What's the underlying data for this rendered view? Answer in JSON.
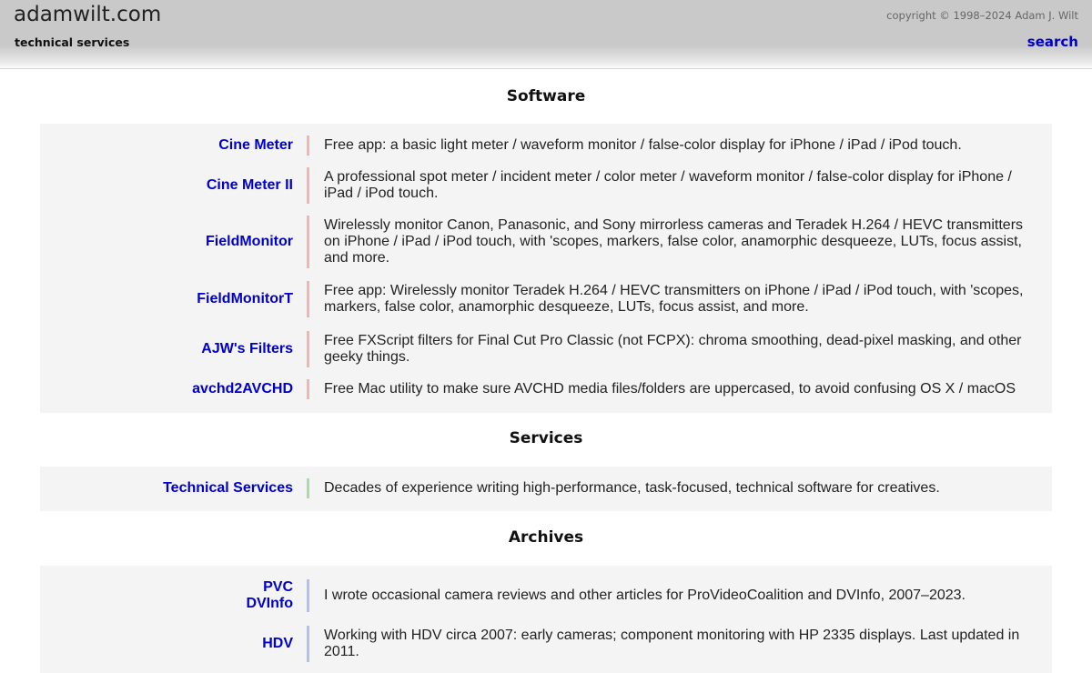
{
  "header": {
    "site_title": "adamwilt.com",
    "site_subtitle": "technical services",
    "copyright": "copyright © 1998–2024 Adam J. Wilt",
    "search_label": "search"
  },
  "sections": {
    "software": {
      "heading": "Software",
      "items": [
        {
          "name": "Cine Meter",
          "desc": "Free app: a basic light meter / waveform monitor / false-color display for iPhone / iPad / iPod touch."
        },
        {
          "name": "Cine Meter II",
          "desc": "A professional spot meter / incident meter / color meter / waveform monitor / false-color display for iPhone / iPad / iPod touch."
        },
        {
          "name": "FieldMonitor",
          "desc": "Wirelessly monitor Canon, Panasonic, and Sony mirrorless cameras and Teradek H.264 / HEVC transmitters on iPhone / iPad / iPod touch, with 'scopes, markers, false color, anamorphic desqueeze, LUTs, focus assist, and more."
        },
        {
          "name": "FieldMonitorT",
          "desc": "Free app: Wirelessly monitor Teradek H.264 / HEVC transmitters on iPhone / iPad / iPod touch, with 'scopes, markers, false color, anamorphic desqueeze, LUTs, focus assist, and more."
        },
        {
          "name": "AJW's Filters",
          "desc": "Free FXScript filters for Final Cut Pro Classic (not FCPX): chroma smoothing, dead-pixel masking, and other geeky things."
        },
        {
          "name": "avchd2AVCHD",
          "desc": "Free Mac utility to make sure AVCHD media files/folders are uppercased, to avoid confusing OS X / macOS"
        }
      ]
    },
    "services": {
      "heading": "Services",
      "items": [
        {
          "name": "Technical Services",
          "desc": "Decades of experience writing high-performance, task-focused, technical software for creatives."
        }
      ]
    },
    "archives": {
      "heading": "Archives",
      "items": [
        {
          "name_line1": "PVC",
          "name_line2": "DVInfo",
          "desc": "I wrote occasional camera reviews and other articles for ProVideoCoalition and DVInfo, 2007–2023."
        },
        {
          "name": "HDV",
          "desc": "Working with HDV circa 2007: early cameras; component monitoring with HP 2335 displays. Last updated in 2011."
        }
      ]
    }
  },
  "colors": {
    "link": "#0000cc",
    "software_bar": "#f2b3b3",
    "services_bar": "#a6dca6",
    "archives_bar": "#b3bff0",
    "panel_bg": "#f4f4f4",
    "header_bg": "#c9c9c9"
  }
}
